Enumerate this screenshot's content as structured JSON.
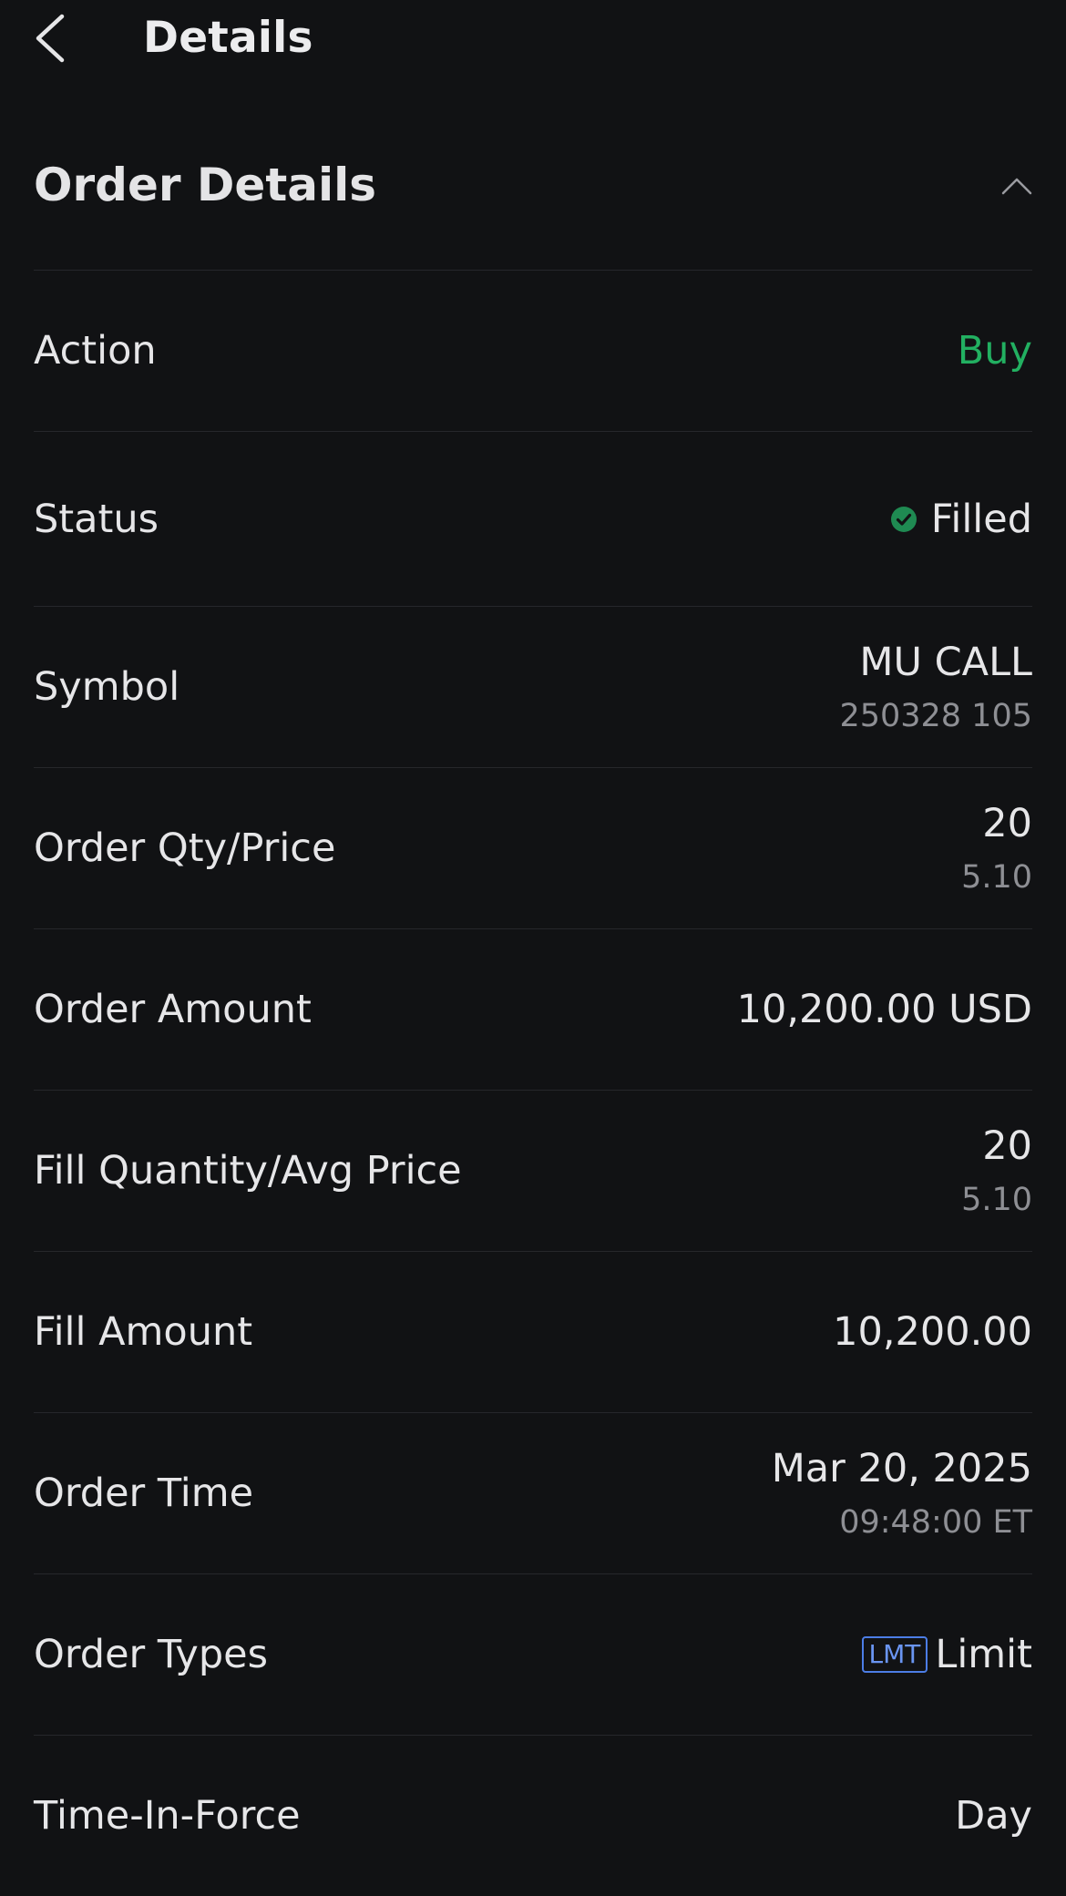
{
  "header": {
    "title": "Details",
    "back_icon": "chevron-left-icon"
  },
  "section": {
    "title": "Order Details",
    "collapse_icon": "chevron-up-icon"
  },
  "colors": {
    "background": "#111214",
    "buy": "#22b061",
    "filled": "#1f8a52",
    "badge": "#4c7de6"
  },
  "rows": {
    "action": {
      "label": "Action",
      "value": "Buy"
    },
    "status": {
      "label": "Status",
      "value": "Filled",
      "icon": "check-circle-icon"
    },
    "symbol": {
      "label": "Symbol",
      "value": "MU CALL",
      "sub": "250328 105"
    },
    "order_qty_price": {
      "label": "Order Qty/Price",
      "value": "20",
      "sub": "5.10"
    },
    "order_amount": {
      "label": "Order Amount",
      "value": "10,200.00 USD"
    },
    "fill_qty_avg": {
      "label": "Fill Quantity/Avg Price",
      "value": "20",
      "sub": "5.10"
    },
    "fill_amount": {
      "label": "Fill Amount",
      "value": "10,200.00"
    },
    "order_time": {
      "label": "Order Time",
      "value": "Mar 20, 2025",
      "sub": "09:48:00 ET"
    },
    "order_types": {
      "label": "Order Types",
      "badge": "LMT",
      "value": "Limit"
    },
    "time_in_force": {
      "label": "Time-In-Force",
      "value": "Day"
    }
  }
}
